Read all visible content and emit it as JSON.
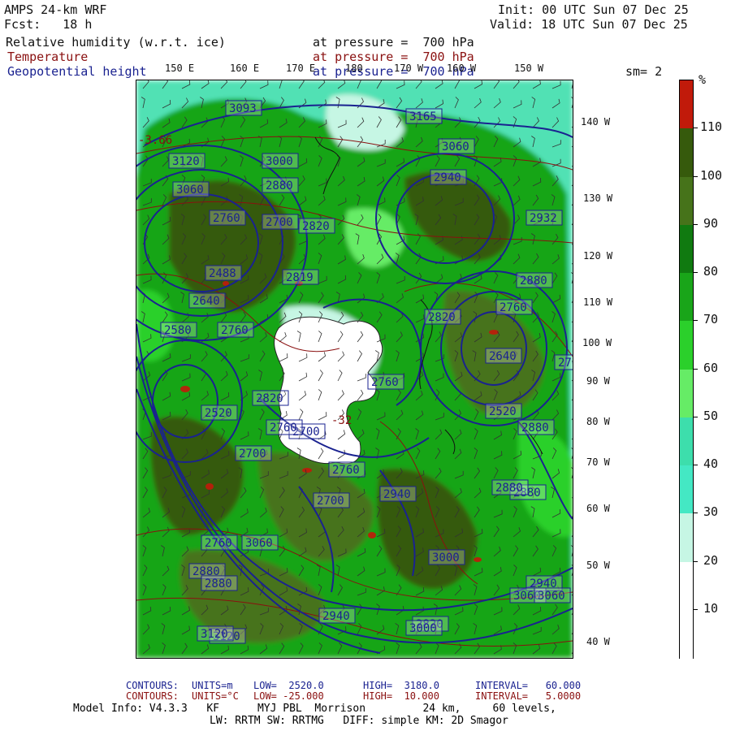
{
  "header": {
    "model": "AMPS 24-km WRF",
    "fcst": "Fcst:   18 h",
    "init": "Init: 00 UTC Sun 07 Dec 25",
    "valid": "Valid: 18 UTC Sun 07 Dec 25",
    "field1": "Relative humidity (w.r.t. ice)",
    "field1_level": "at pressure =  700 hPa",
    "field2": "Temperature",
    "field2_level": "at pressure =  700 hPa",
    "field3": "Geopotential height",
    "field3_level": "at pressure =  700 hPa",
    "sm": "sm= 2"
  },
  "colors": {
    "height_contour": "#1a2290",
    "temp_contour": "#8a1010",
    "wind_barb": "#333333"
  },
  "map": {
    "lon_labels_top": [
      "150 E",
      "160 E",
      "170 E",
      "180",
      "170 W",
      "160 W",
      "150 W"
    ],
    "lat_labels_right": [
      "140 W",
      "130 W",
      "120 W",
      "110 W",
      "100 W",
      "90 W",
      "80 W",
      "70 W",
      "60 W",
      "50 W",
      "40 W"
    ],
    "height_labels": [
      "3093",
      "3165",
      "3060",
      "3000",
      "3120",
      "2940",
      "3060",
      "2880",
      "2700",
      "2760",
      "2820",
      "2932",
      "2760",
      "2488",
      "2819",
      "2880",
      "2640",
      "2820",
      "2580",
      "2760",
      "2640",
      "2760",
      "2520",
      "2760",
      "2520",
      "2880",
      "2820",
      "2700",
      "2760",
      "2760",
      "2700",
      "2880",
      "2880",
      "2700",
      "2760",
      "2940",
      "2880",
      "3000",
      "3060",
      "2820",
      "2940",
      "3060",
      "2940",
      "2880",
      "3000",
      "3120",
      "3060",
      "3120"
    ],
    "temp_labels": [
      "-3.66",
      "-32"
    ]
  },
  "colorbar": {
    "unit": "%",
    "levels": [
      "110",
      "100",
      "90",
      "80",
      "70",
      "60",
      "50",
      "40",
      "30",
      "20",
      "10"
    ],
    "segments": [
      "#c11a0a",
      "#365a0c",
      "#46731a",
      "#107a10",
      "#19a519",
      "#2bd02b",
      "#66ec66",
      "#3ddeac",
      "#44e8c4",
      "#c6f6e4",
      "#ffffff",
      "#ffffff"
    ]
  },
  "footer": {
    "contours_lab": "CONTOURS:",
    "units_height": "UNITS=m",
    "low_height": "LOW=  2520.0",
    "high_height": "HIGH=  3180.0",
    "interval_height": "INTERVAL=   60.000",
    "units_temp": "UNITS=°C",
    "low_temp": "LOW= -25.000",
    "high_temp": "HIGH=  10.000",
    "interval_temp": "INTERVAL=   5.0000",
    "model_info": "Model Info: V4.3.3   KF      MYJ PBL  Morrison         24 km,     60 levels,",
    "physics": "LW: RRTM SW: RRTMG   DIFF: simple KM: 2D Smagor"
  }
}
